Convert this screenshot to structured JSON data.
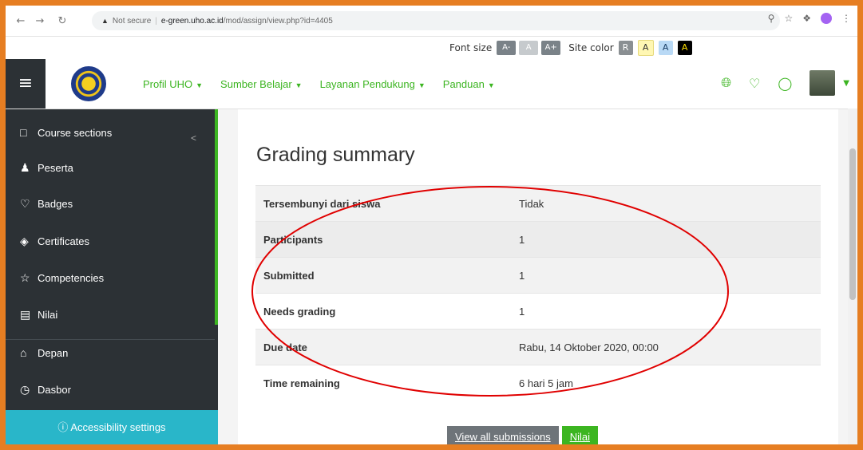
{
  "browser": {
    "security": "Not secure",
    "url_host": "e-green.uho.ac.id",
    "url_path": "/mod/assign/view.php?id=4405"
  },
  "accessibility": {
    "font_size_label": "Font size",
    "font_buttons": [
      "A-",
      "A",
      "A+"
    ],
    "site_color_label": "Site color",
    "color_buttons": [
      {
        "label": "R",
        "bg": "#8a8f92",
        "fg": "#ffffff"
      },
      {
        "label": "A",
        "bg": "#fff7b3",
        "fg": "#333333"
      },
      {
        "label": "A",
        "bg": "#b9d9f5",
        "fg": "#1a3e66"
      },
      {
        "label": "A",
        "bg": "#000000",
        "fg": "#ffe000"
      }
    ]
  },
  "navbar": {
    "menu": [
      "Profil UHO",
      "Sumber Belajar",
      "Layanan Pendukung",
      "Panduan"
    ]
  },
  "sidebar": {
    "items": [
      {
        "icon": "folder-icon",
        "label": "Course sections"
      },
      {
        "icon": "users-icon",
        "label": "Peserta"
      },
      {
        "icon": "badge-icon",
        "label": "Badges"
      },
      {
        "icon": "certificate-icon",
        "label": "Certificates"
      },
      {
        "icon": "star-icon",
        "label": "Competencies"
      },
      {
        "icon": "gradebook-icon",
        "label": "Nilai"
      },
      {
        "icon": "home-icon",
        "label": "Depan"
      },
      {
        "icon": "dashboard-icon",
        "label": "Dasbor"
      }
    ],
    "accessibility_button": "Accessibility settings"
  },
  "main": {
    "heading": "Grading summary",
    "rows": [
      {
        "key": "Tersembunyi dari siswa",
        "value": "Tidak"
      },
      {
        "key": "Participants",
        "value": "1"
      },
      {
        "key": "Submitted",
        "value": "1"
      },
      {
        "key": "Needs grading",
        "value": "1"
      },
      {
        "key": "Due date",
        "value": "Rabu, 14 Oktober 2020, 00:00"
      },
      {
        "key": "Time remaining",
        "value": "6 hari 5 jam"
      }
    ],
    "buttons": {
      "view_all": "View all submissions",
      "grade": "Nilai"
    }
  },
  "colors": {
    "accent": "#3cb521",
    "sidebar": "#2c3135",
    "annotation": "#e00000",
    "border": "#e67e22"
  }
}
